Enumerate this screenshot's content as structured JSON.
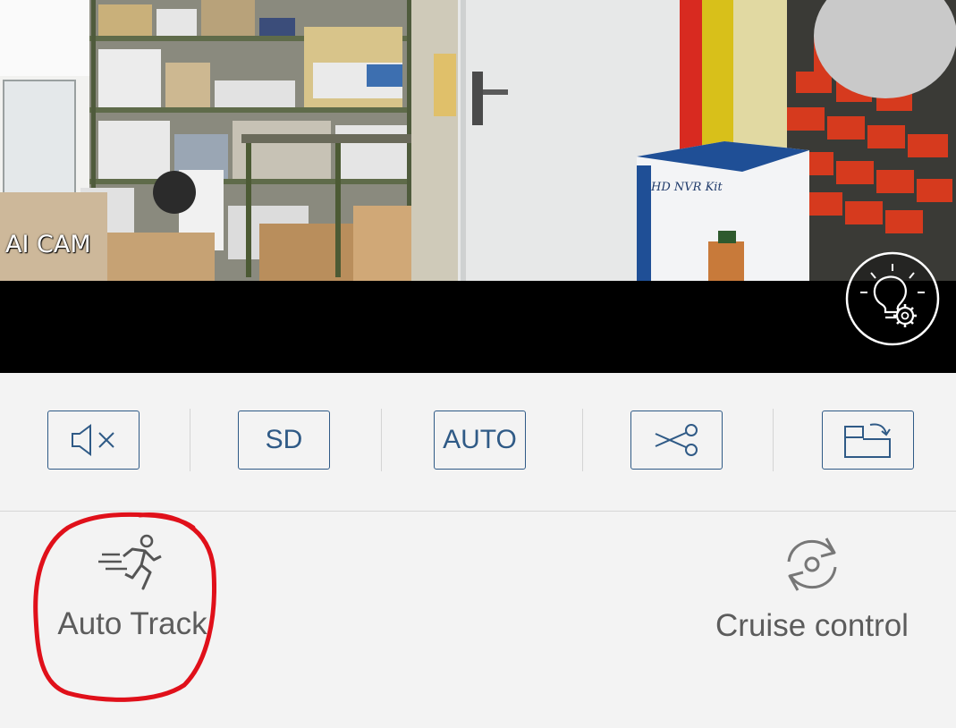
{
  "video": {
    "camera_label": "AI CAM",
    "box_label": "HD NVR Kit",
    "light_settings_icon": "lightbulb-gear-icon"
  },
  "toolbar": {
    "buttons": [
      {
        "name": "mute-button",
        "icon": "speaker-muted-icon",
        "label": ""
      },
      {
        "name": "quality-button",
        "icon": "",
        "label": "SD"
      },
      {
        "name": "mode-button",
        "icon": "",
        "label": "AUTO"
      },
      {
        "name": "clip-button",
        "icon": "scissors-icon",
        "label": ""
      },
      {
        "name": "rotate-button",
        "icon": "rotate-screen-icon",
        "label": ""
      }
    ]
  },
  "features": {
    "auto_track": {
      "label": "Auto Track",
      "icon": "running-person-icon"
    },
    "cruise_control": {
      "label": "Cruise control",
      "icon": "rotate-cycle-icon"
    }
  },
  "colors": {
    "accent": "#2f5a86",
    "annotation": "#e0101a",
    "background": "#f3f3f3",
    "label": "#5c5c5c"
  }
}
